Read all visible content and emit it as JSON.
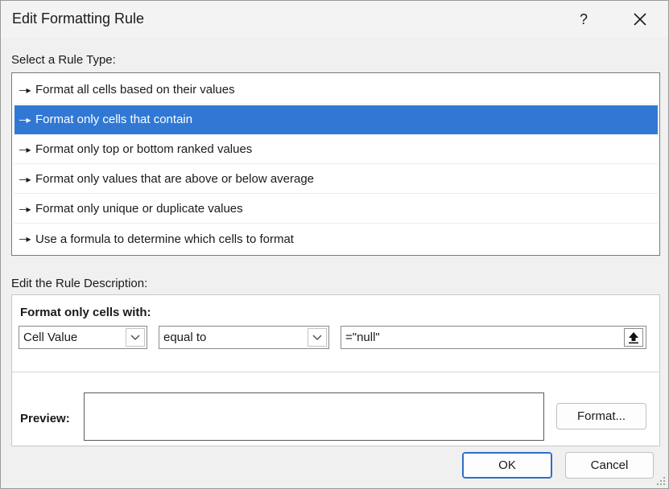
{
  "window": {
    "title": "Edit Formatting Rule",
    "help_label": "?",
    "close_icon": "close-icon"
  },
  "rule_type": {
    "label": "Select a Rule Type:",
    "items": [
      {
        "label": "Format all cells based on their values",
        "selected": false
      },
      {
        "label": "Format only cells that contain",
        "selected": true
      },
      {
        "label": "Format only top or bottom ranked values",
        "selected": false
      },
      {
        "label": "Format only values that are above or below average",
        "selected": false
      },
      {
        "label": "Format only unique or duplicate values",
        "selected": false
      },
      {
        "label": "Use a formula to determine which cells to format",
        "selected": false
      }
    ],
    "bullet_glyph": "➤"
  },
  "description": {
    "label": "Edit the Rule Description:",
    "heading": "Format only cells with:",
    "condition_type": "Cell Value",
    "operator": "equal to",
    "value": "=\"null\"",
    "preview_label": "Preview:",
    "format_button": "Format..."
  },
  "footer": {
    "ok_label": "OK",
    "cancel_label": "Cancel"
  },
  "colors": {
    "selection": "#3178d4",
    "default_button_border": "#2b6fc7"
  }
}
